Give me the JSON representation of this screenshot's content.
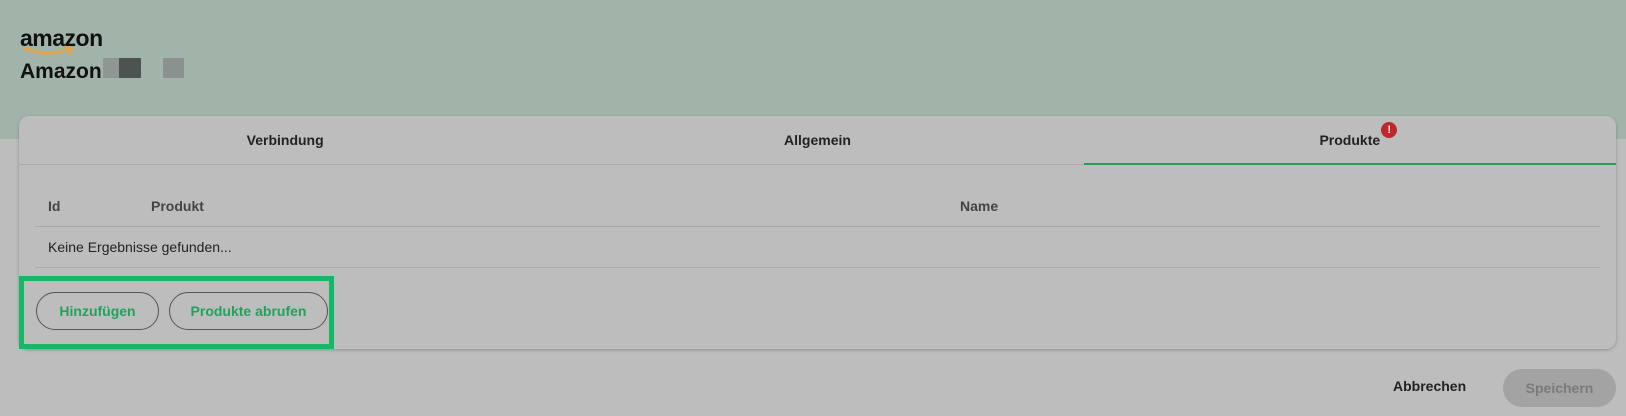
{
  "header": {
    "logo_text": "amazon",
    "app_title": "Amazon",
    "colors": {
      "band_background": "#a2b4aa",
      "page_background": "#bdbdbd",
      "accent": "#1fa35a",
      "highlight_border": "#17b865",
      "alert": "#c0272d",
      "logo_smile": "#e8a33b"
    }
  },
  "tabs": [
    {
      "label": "Verbindung",
      "active": false
    },
    {
      "label": "Allgemein",
      "active": false
    },
    {
      "label": "Produkte",
      "active": true,
      "badge": "!"
    }
  ],
  "table": {
    "columns": [
      "Id",
      "Produkt",
      "Name"
    ],
    "empty_message": "Keine Ergebnisse gefunden..."
  },
  "actions": {
    "add_label": "Hinzufügen",
    "fetch_label": "Produkte abrufen"
  },
  "footer": {
    "cancel_label": "Abbrechen",
    "save_label": "Speichern",
    "save_disabled": true
  }
}
